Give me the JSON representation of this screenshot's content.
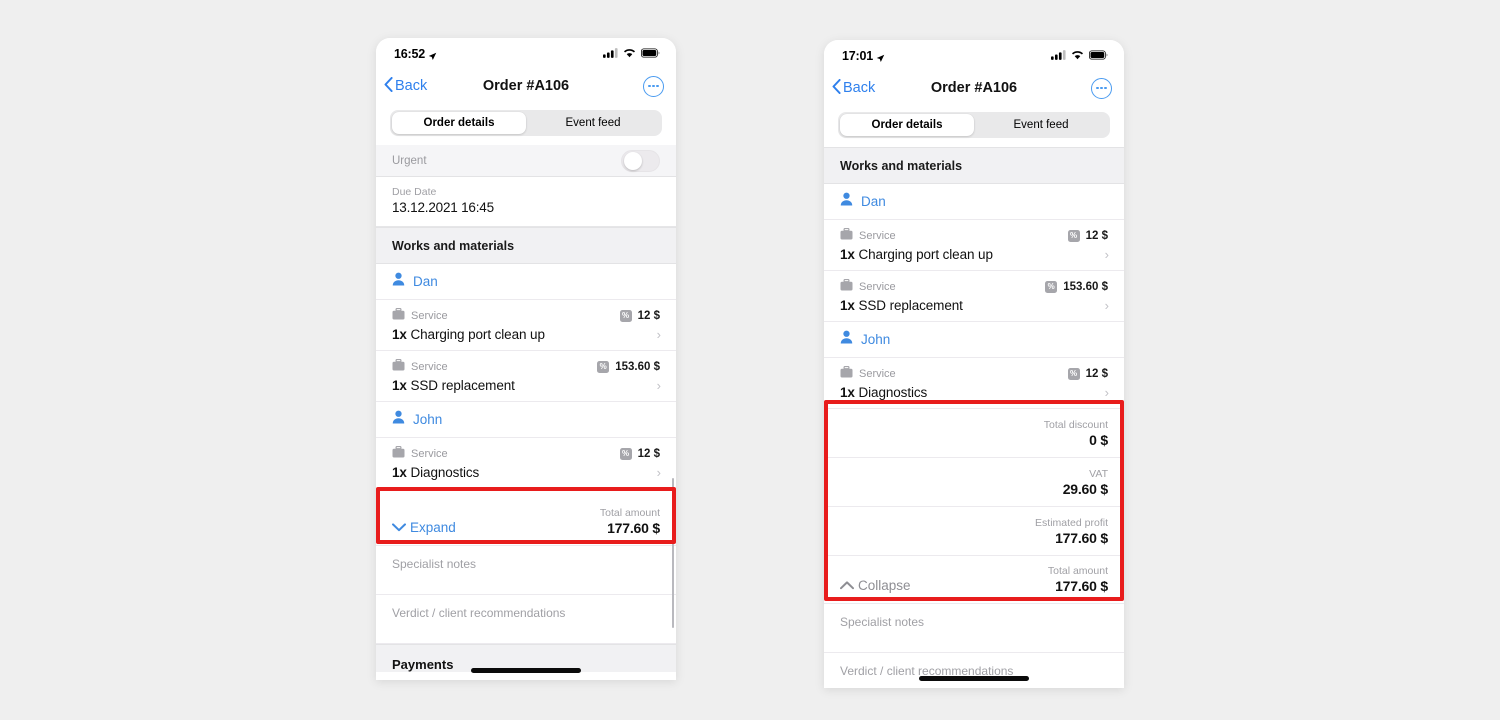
{
  "background_color": "#efefef",
  "accent_color": "#3f8ae0",
  "highlight_color": "#e81c1c",
  "phones": [
    {
      "id": "left",
      "status": {
        "time": "16:52",
        "location_icon": "location-arrow-icon",
        "signal_icon": "cellular-signal-icon",
        "wifi_icon": "wifi-icon",
        "battery_icon": "battery-icon"
      },
      "nav": {
        "back_label": "Back",
        "title": "Order #A106",
        "more_icon": "more-options-icon"
      },
      "tabs": [
        {
          "label": "Order details",
          "active": true
        },
        {
          "label": "Event feed",
          "active": false
        }
      ],
      "urgent": {
        "label": "Urgent",
        "state": "off"
      },
      "due_date": {
        "label": "Due Date",
        "value": "13.12.2021 16:45"
      },
      "section_title": "Works and materials",
      "groups": [
        {
          "person": "Dan",
          "items": [
            {
              "kind": "Service",
              "qty": "1x",
              "title": "Charging port clean up",
              "price": "12 $",
              "discount_badge": "%"
            },
            {
              "kind": "Service",
              "qty": "1x",
              "title": "SSD replacement",
              "price": "153.60 $",
              "discount_badge": "%"
            }
          ]
        },
        {
          "person": "John",
          "items": [
            {
              "kind": "Service",
              "qty": "1x",
              "title": "Diagnostics",
              "price": "12 $",
              "discount_badge": "%"
            }
          ]
        }
      ],
      "totals": [
        {
          "action": "Expand",
          "action_icon": "chevron-down-icon",
          "label": "Total amount",
          "value": "177.60 $"
        }
      ],
      "notes": [
        {
          "placeholder": "Specialist notes"
        },
        {
          "placeholder": "Verdict / client recommendations"
        }
      ],
      "footer": "Payments"
    },
    {
      "id": "right",
      "status": {
        "time": "17:01",
        "location_icon": "location-arrow-icon",
        "signal_icon": "cellular-signal-icon",
        "wifi_icon": "wifi-icon",
        "battery_icon": "battery-icon"
      },
      "nav": {
        "back_label": "Back",
        "title": "Order #A106",
        "more_icon": "more-options-icon"
      },
      "tabs": [
        {
          "label": "Order details",
          "active": true
        },
        {
          "label": "Event feed",
          "active": false
        }
      ],
      "section_title": "Works and materials",
      "groups": [
        {
          "person": "Dan",
          "items": [
            {
              "kind": "Service",
              "qty": "1x",
              "title": "Charging port clean up",
              "price": "12 $",
              "discount_badge": "%"
            },
            {
              "kind": "Service",
              "qty": "1x",
              "title": "SSD replacement",
              "price": "153.60 $",
              "discount_badge": "%"
            }
          ]
        },
        {
          "person": "John",
          "items": [
            {
              "kind": "Service",
              "qty": "1x",
              "title": "Diagnostics",
              "price": "12 $",
              "discount_badge": "%"
            }
          ]
        }
      ],
      "totals": [
        {
          "action": "",
          "label": "Total discount",
          "value": "0 $"
        },
        {
          "action": "",
          "label": "VAT",
          "value": "29.60 $"
        },
        {
          "action": "",
          "label": "Estimated profit",
          "value": "177.60 $"
        },
        {
          "action": "Collapse",
          "action_icon": "chevron-up-icon",
          "label": "Total amount",
          "value": "177.60 $"
        }
      ],
      "notes": [
        {
          "placeholder": "Specialist notes"
        },
        {
          "placeholder": "Verdict / client recommendations"
        }
      ]
    }
  ]
}
